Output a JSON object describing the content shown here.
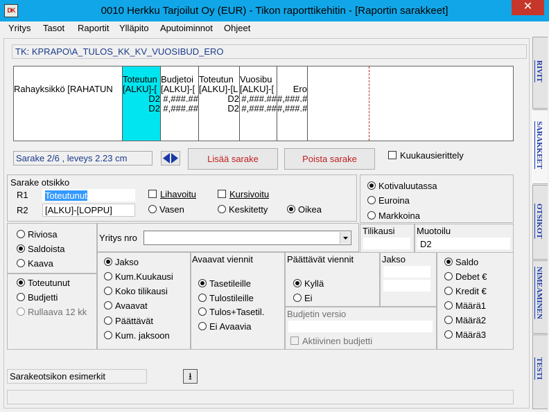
{
  "window": {
    "title": "0010  Herkku Tarjoilut Oy (EUR) - Tikon raporttikehitin - [Raportin sarakkeet]",
    "app_icon_text": "DK",
    "close_symbol": "✕"
  },
  "menu": [
    "Yritys",
    "Tasot",
    "Raportit",
    "Ylläpito",
    "Aputoiminnot",
    "Ohjeet"
  ],
  "report_path": "TK: KPRAPO\\A_TULOS_KK_KV_VUOSIBUD_ERO",
  "grid": {
    "row_header": "Rahayksikkö [RAHATUN",
    "columns": [
      {
        "l1": "Toteutun",
        "l2": "[ALKU]-[",
        "v1": "D2",
        "v2": "D2"
      },
      {
        "l1": "Budjetoi",
        "l2": "[ALKU]-[",
        "v1": "#,###.##",
        "v2": "#,###.##"
      },
      {
        "l1": "Toteutun",
        "l2": "[ALKU]-[L",
        "v1": "D2",
        "v2": "D2"
      },
      {
        "l1": "Vuosibu",
        "l2": "[ALKU]-[",
        "v1": "#,###.##",
        "v2": "#,###.##"
      },
      {
        "l1": "",
        "l2": "Ero",
        "v1": "#,###.#",
        "v2": "#,###.#"
      }
    ]
  },
  "status": "Sarake 2/6 , leveys  2.23 cm",
  "buttons": {
    "add_column": "Lisää sarake",
    "remove_column": "Poista sarake"
  },
  "monthly_breakdown": {
    "label": "Kuukausierittely",
    "checked": false
  },
  "column_heading": {
    "section_label": "Sarake otsikko",
    "r1_label": "R1",
    "r1_value": "Toteutunut",
    "r2_label": "R2",
    "r2_value": "[ALKU]-[LOPPU]",
    "bold": "Lihavoitu",
    "italic": "Kursivoitu",
    "align_left": "Vasen",
    "align_center": "Keskitetty",
    "align_right": "Oikea"
  },
  "currency": {
    "home": "Kotivaluutassa",
    "euro": "Euroina",
    "markka": "Markkoina"
  },
  "account_period": {
    "label": "Tilikausi",
    "value": ""
  },
  "format": {
    "label": "Muotoilu",
    "value": "D2"
  },
  "row_type": {
    "row": "Riviosa",
    "balance": "Saldoista",
    "formula": "Kaava"
  },
  "data_type": {
    "actual": "Toteutunut",
    "budget": "Budjetti",
    "rolling": "Rullaava 12 kk"
  },
  "company_no": {
    "label": "Yritys nro",
    "value": ""
  },
  "period": {
    "period": "Jakso",
    "cum_months": "Kum.Kuukausi",
    "whole_year": "Koko tilikausi",
    "opening": "Avaavat",
    "closing": "Päättävät",
    "cum_to_period": "Kum. jaksoon"
  },
  "opening_entries": {
    "label": "Avaavat viennit",
    "balance_accounts": "Tasetileille",
    "pl_accounts": "Tulostileille",
    "both": "Tulos+Tasetil.",
    "none": "Ei Avaavia"
  },
  "closing_entries": {
    "label": "Päättävät viennit",
    "yes": "Kyllä",
    "no": "Ei"
  },
  "period_field": {
    "label": "Jakso",
    "value1": "",
    "value2": ""
  },
  "budget_version": {
    "label": "Budjetin versio",
    "value": "",
    "active_label": "Aktiivinen budjetti"
  },
  "amount_type": {
    "balance": "Saldo",
    "debit": "Debet €",
    "credit": "Kredit €",
    "qty1": "Määrä1",
    "qty2": "Määrä2",
    "qty3": "Määrä3"
  },
  "examples": {
    "label": "Sarakeotsikon esimerkit",
    "button_symbol": "⭳"
  },
  "side_tabs": [
    "RIVIT",
    "SARAKKEET",
    "OTSIKOT",
    "NIMEAMINEN",
    "TESTI"
  ]
}
